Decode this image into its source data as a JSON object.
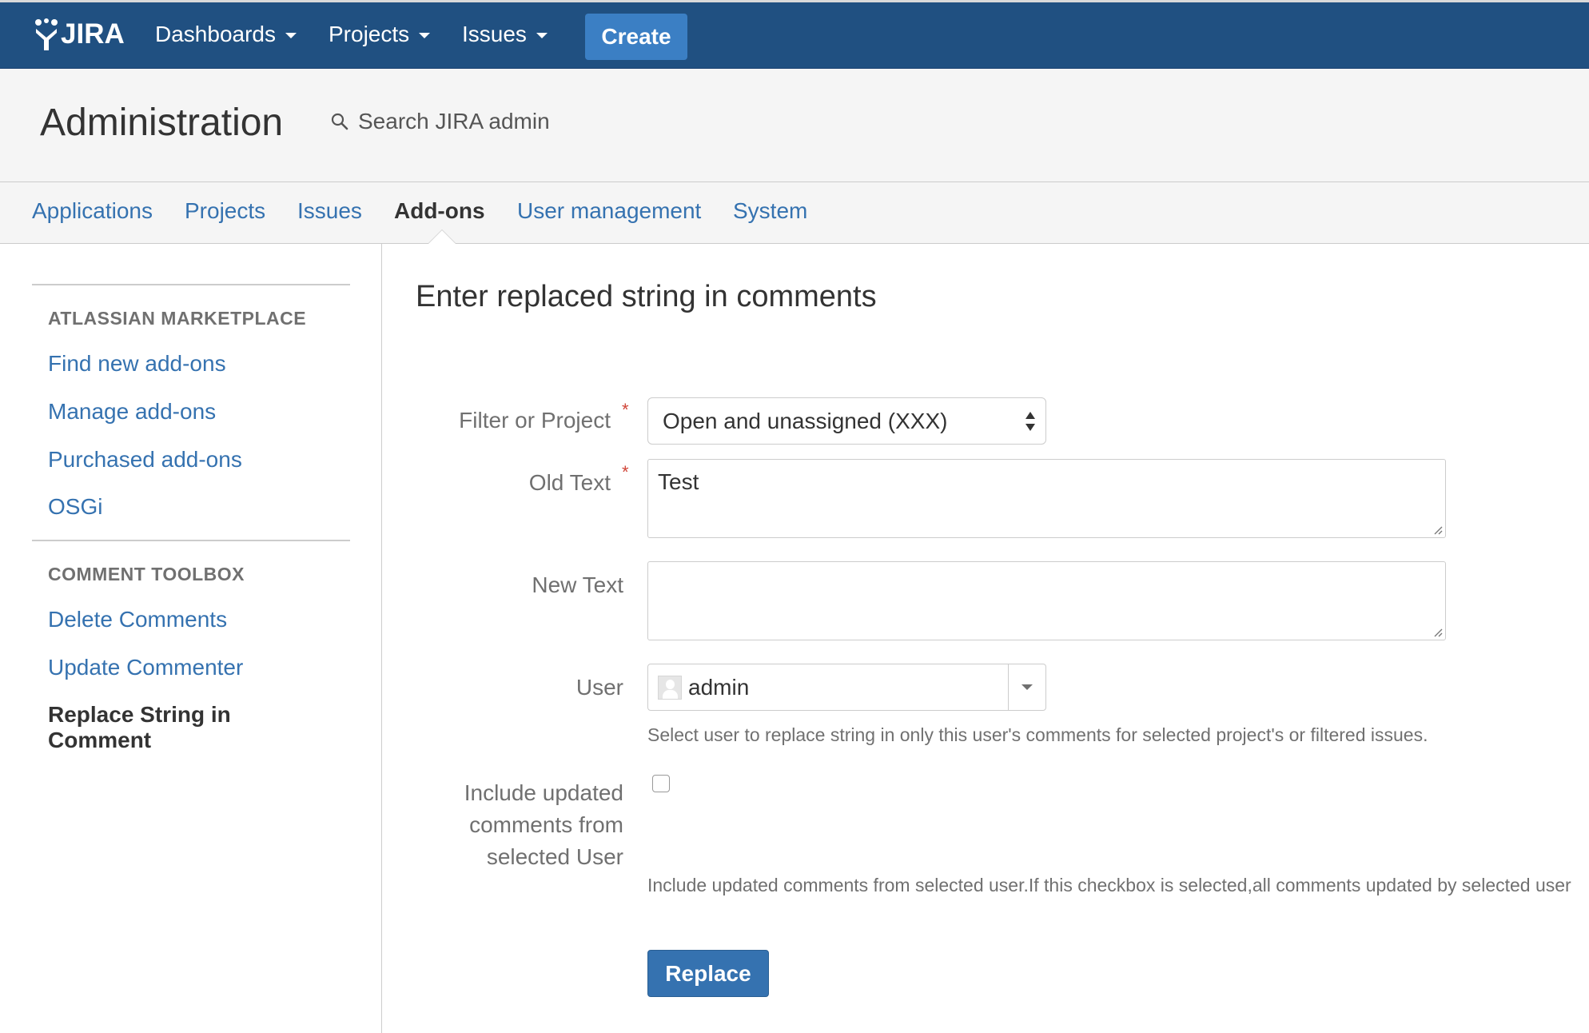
{
  "topnav": {
    "logo_text": "JIRA",
    "items": [
      {
        "label": "Dashboards"
      },
      {
        "label": "Projects"
      },
      {
        "label": "Issues"
      }
    ],
    "create_label": "Create"
  },
  "admin": {
    "title": "Administration",
    "search_placeholder": "Search JIRA admin"
  },
  "tabs": [
    {
      "label": "Applications"
    },
    {
      "label": "Projects"
    },
    {
      "label": "Issues"
    },
    {
      "label": "Add-ons",
      "active": true
    },
    {
      "label": "User management"
    },
    {
      "label": "System"
    }
  ],
  "sidebar": {
    "sections": [
      {
        "heading": "ATLASSIAN MARKETPLACE",
        "links": [
          "Find new add-ons",
          "Manage add-ons",
          "Purchased add-ons",
          "OSGi"
        ]
      },
      {
        "heading": "COMMENT TOOLBOX",
        "links": [
          "Delete Comments",
          "Update Commenter",
          "Replace String in Comment"
        ],
        "active": "Replace String in Comment"
      }
    ]
  },
  "form": {
    "heading": "Enter replaced string in comments",
    "filter_label": "Filter or Project",
    "filter_value": "Open and unassigned (XXX)",
    "old_text_label": "Old Text",
    "old_text_value": "Test",
    "new_text_label": "New Text",
    "new_text_value": "",
    "user_label": "User",
    "user_value": "admin",
    "user_description": "Select user to replace string in only this user's comments for selected project's or filtered issues.",
    "include_label_1": "Include updated",
    "include_label_2": "comments from",
    "include_label_3": "selected User",
    "include_checked": false,
    "include_description": "Include updated comments from selected user.If this checkbox is selected,all comments updated by selected user",
    "submit_label": "Replace",
    "required_marker": "*"
  },
  "colors": {
    "header_bg": "#205081",
    "create_button": "#3b7fc4",
    "link": "#3572b0",
    "required": "#d04437"
  }
}
